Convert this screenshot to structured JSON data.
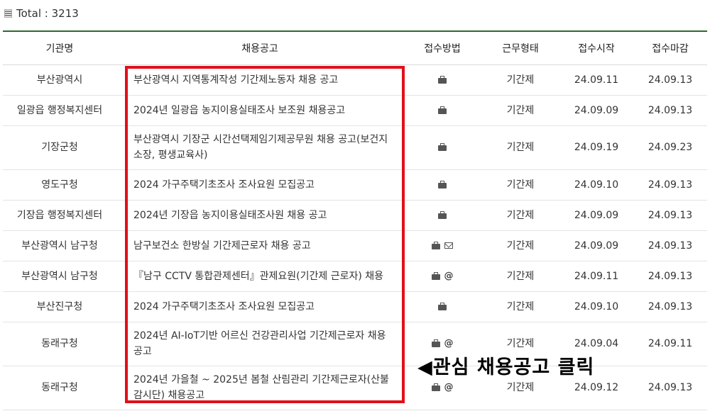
{
  "summary": {
    "total_label": "Total : 3213"
  },
  "table": {
    "headers": [
      "기관명",
      "채용공고",
      "접수방법",
      "근무형태",
      "접수시작",
      "접수마감"
    ],
    "rows": [
      {
        "org": "부산광역시",
        "title": "부산광역시 지역통계작성 기간제노동자 채용 공고",
        "methods": [
          "briefcase-icon"
        ],
        "type": "기간제",
        "start": "24.09.11",
        "end": "24.09.13"
      },
      {
        "org": "일광읍 행정복지센터",
        "title": "2024년 일광읍 농지이용실태조사 보조원 채용공고",
        "methods": [
          "briefcase-icon"
        ],
        "type": "기간제",
        "start": "24.09.09",
        "end": "24.09.13"
      },
      {
        "org": "기장군청",
        "title": "부산광역시 기장군 시간선택제임기제공무원 채용 공고(보건지소장, 평생교육사)",
        "methods": [
          "briefcase-icon"
        ],
        "type": "기간제",
        "start": "24.09.19",
        "end": "24.09.23"
      },
      {
        "org": "영도구청",
        "title": "2024 가구주택기초조사 조사요원 모집공고",
        "methods": [
          "briefcase-icon"
        ],
        "type": "기간제",
        "start": "24.09.10",
        "end": "24.09.13"
      },
      {
        "org": "기장읍 행정복지센터",
        "title": "2024년 기장읍 농지이용실태조사원 채용 공고",
        "methods": [
          "briefcase-icon"
        ],
        "type": "기간제",
        "start": "24.09.09",
        "end": "24.09.13"
      },
      {
        "org": "부산광역시 남구청",
        "title": "남구보건소 한방실 기간제근로자 채용 공고",
        "methods": [
          "briefcase-icon",
          "mail-icon"
        ],
        "type": "기간제",
        "start": "24.09.09",
        "end": "24.09.13"
      },
      {
        "org": "부산광역시 남구청",
        "title": "『남구 CCTV 통합관제센터』관제요원(기간제 근로자) 채용",
        "methods": [
          "briefcase-icon",
          "at-icon"
        ],
        "type": "기간제",
        "start": "24.09.11",
        "end": "24.09.13"
      },
      {
        "org": "부산진구청",
        "title": "2024 가구주택기초조사 조사요원 모집공고",
        "methods": [
          "briefcase-icon"
        ],
        "type": "기간제",
        "start": "24.09.10",
        "end": "24.09.13"
      },
      {
        "org": "동래구청",
        "title": "2024년 AI-IoT기반 어르신 건강관리사업 기간제근로자 채용 공고",
        "methods": [
          "briefcase-icon",
          "at-icon"
        ],
        "type": "기간제",
        "start": "24.09.04",
        "end": "24.09.11"
      },
      {
        "org": "동래구청",
        "title": "2024년 가을철 ~ 2025년 봄철 산림관리 기간제근로자(산불감시단) 채용공고",
        "methods": [
          "briefcase-icon",
          "at-icon"
        ],
        "type": "기간제",
        "start": "24.09.12",
        "end": "24.09.13"
      }
    ]
  },
  "annotation": {
    "text": "◀관심 채용공고 클릭",
    "box_color": "#e0101a"
  },
  "colors": {
    "header_border": "#2e6b2e",
    "highlight": "#e0101a"
  }
}
